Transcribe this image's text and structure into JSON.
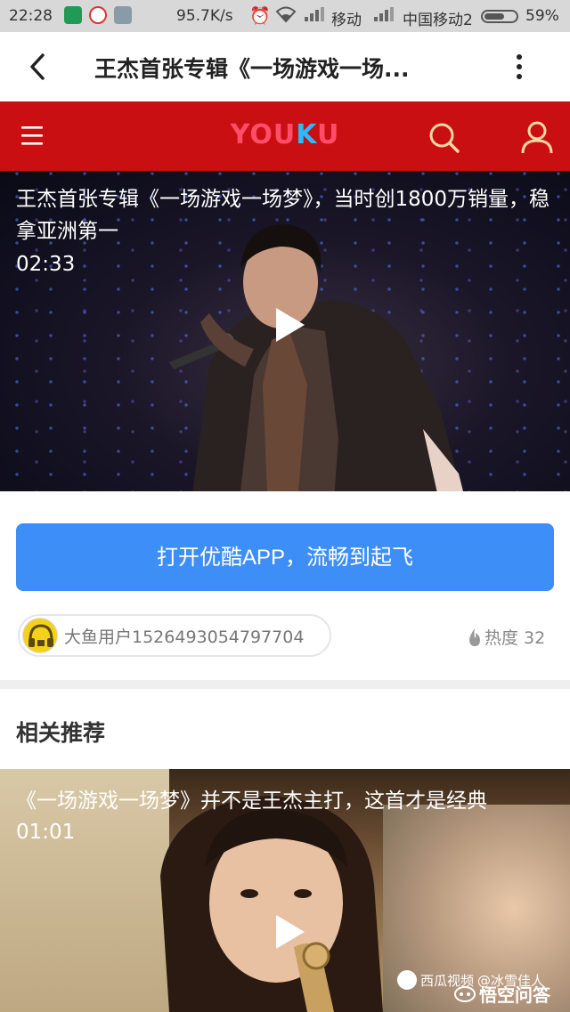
{
  "status_bar": {
    "time": "22:28",
    "net_speed": "95.7K/s",
    "carrier1": "移动",
    "carrier2": "中国移动2",
    "battery": "59%"
  },
  "title_bar": {
    "title": "王杰首张专辑《一场游戏一场..."
  },
  "youku": {
    "logo_left": "YOU",
    "logo_k": "K",
    "logo_right": "U",
    "accent_color": "#c90f12"
  },
  "video": {
    "title": "王杰首张专辑《一场游戏一场梦》，当时创1800万销量，稳拿亚洲第一",
    "duration": "02:33"
  },
  "cta": {
    "label": "打开优酷APP，流畅到起飞",
    "color": "#3e8ef7"
  },
  "author": {
    "name": "大鱼用户1526493054797704",
    "avatar_icon": "headphone-avatar-icon"
  },
  "heat": {
    "label": "热度 32"
  },
  "related": {
    "section_title": "相关推荐",
    "video": {
      "title": "《一场游戏一场梦》并不是王杰主打，这首才是经典",
      "duration": "01:01"
    }
  },
  "watermark": {
    "source": "西瓜视频",
    "author": "@冰雪佳人",
    "brand": "悟空问答"
  }
}
